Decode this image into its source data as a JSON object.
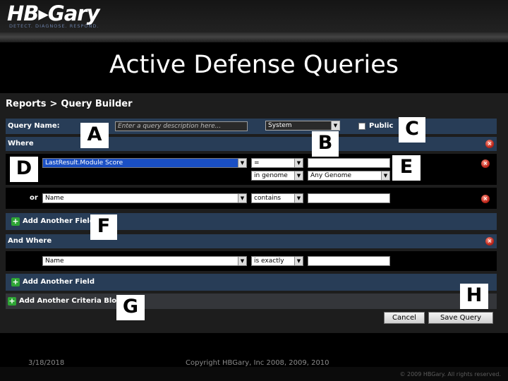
{
  "logo": {
    "name": "HB▸Gary",
    "tagline": "DETECT. DIAGNOSE. RESPOND."
  },
  "slide_title": "Active Defense Queries",
  "breadcrumb": {
    "parent": "Reports",
    "separator": ">",
    "current": "Query Builder"
  },
  "query": {
    "name_label": "Query Name:",
    "description_placeholder": "Enter a query description here...",
    "scope_select": "System",
    "public_label": "Public"
  },
  "where_block": {
    "label": "Where",
    "condition_1": {
      "field": "LastResult.Module Score",
      "operator": "=",
      "value": ""
    },
    "condition_1b": {
      "field": "in genome",
      "operator": "Any Genome"
    },
    "or_label": "or",
    "condition_2": {
      "field": "Name",
      "operator": "contains",
      "value": ""
    },
    "add_field": "Add Another Field"
  },
  "and_where_block": {
    "label": "And Where",
    "condition_1": {
      "field": "Name",
      "operator": "is exactly",
      "value": ""
    },
    "add_field": "Add Another Field"
  },
  "add_criteria_block": "Add Another Criteria Block",
  "buttons": {
    "cancel": "Cancel",
    "save_query": "Save Query"
  },
  "callouts": {
    "a": "A",
    "b": "B",
    "c": "C",
    "d": "D",
    "e": "E",
    "f": "F",
    "g": "G",
    "h": "H"
  },
  "footer": {
    "date": "3/18/2018",
    "copyright": "Copyright HBGary, Inc 2008, 2009, 2010",
    "rights": "© 2009 HBGary.  All rights reserved."
  },
  "colors": {
    "band": "#283d57",
    "panel": "#1d1d1d",
    "selection": "#1a4fc4",
    "remove": "#c0281c",
    "add": "#2ea535"
  },
  "icons": {
    "remove": "close-circle-icon",
    "add": "plus-square-icon",
    "dropdown": "chevron-down-icon"
  }
}
